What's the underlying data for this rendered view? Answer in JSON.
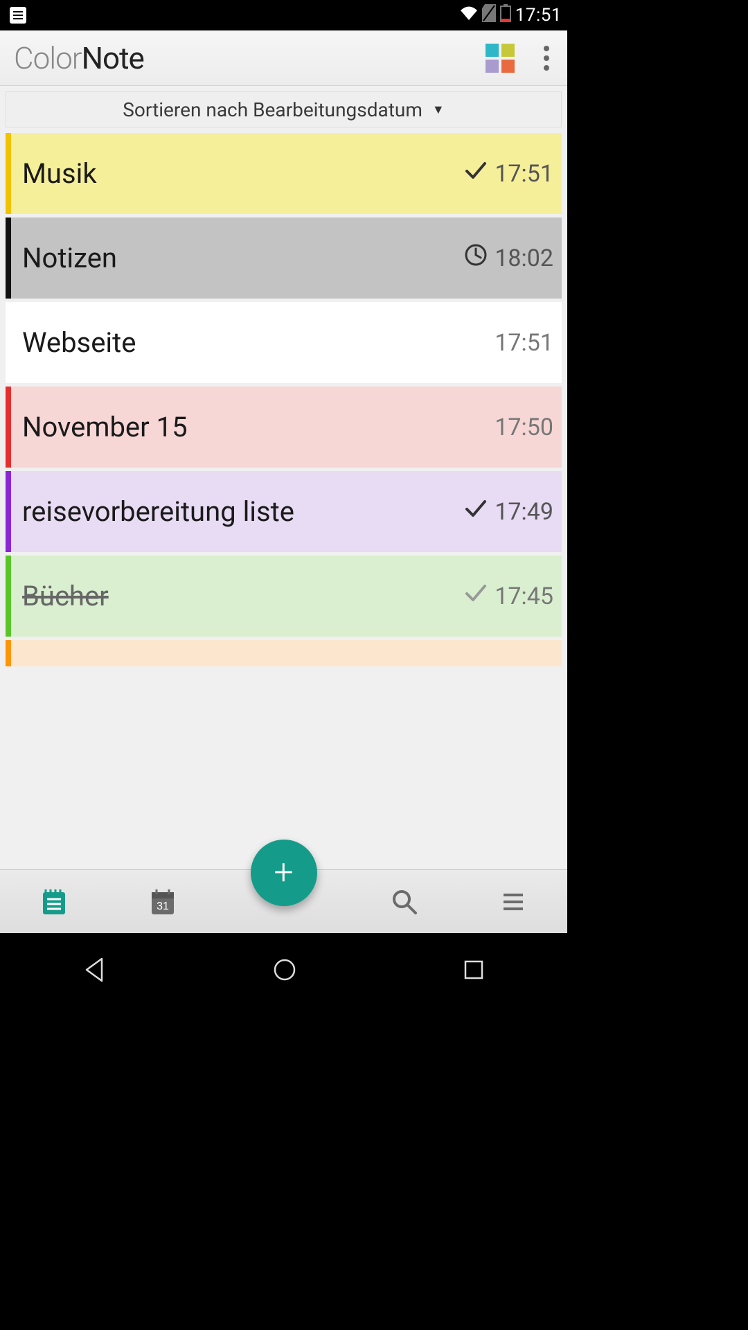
{
  "status": {
    "time": "17:51"
  },
  "header": {
    "logo_left": "Color",
    "logo_right": "Note",
    "grid_colors": [
      "#2fb7c8",
      "#c6c83a",
      "#a99bce",
      "#e86a3e"
    ]
  },
  "sort": {
    "label": "Sortieren nach Bearbeitungsdatum"
  },
  "notes": [
    {
      "title": "Musik",
      "time": "17:51",
      "icon": "check",
      "color": "yellow",
      "strike": false
    },
    {
      "title": "Notizen",
      "time": "18:02",
      "icon": "clock",
      "color": "gray",
      "strike": false
    },
    {
      "title": "Webseite",
      "time": "17:51",
      "icon": "none",
      "color": "white",
      "strike": false
    },
    {
      "title": "November 15",
      "time": "17:50",
      "icon": "none",
      "color": "red",
      "strike": false
    },
    {
      "title": "reisevorbereitung liste",
      "time": "17:49",
      "icon": "check",
      "color": "purple",
      "strike": false
    },
    {
      "title": "Bücher",
      "time": "17:45",
      "icon": "check",
      "color": "green",
      "strike": true
    },
    {
      "title": "",
      "time": "",
      "icon": "none",
      "color": "orange",
      "strike": false
    }
  ]
}
